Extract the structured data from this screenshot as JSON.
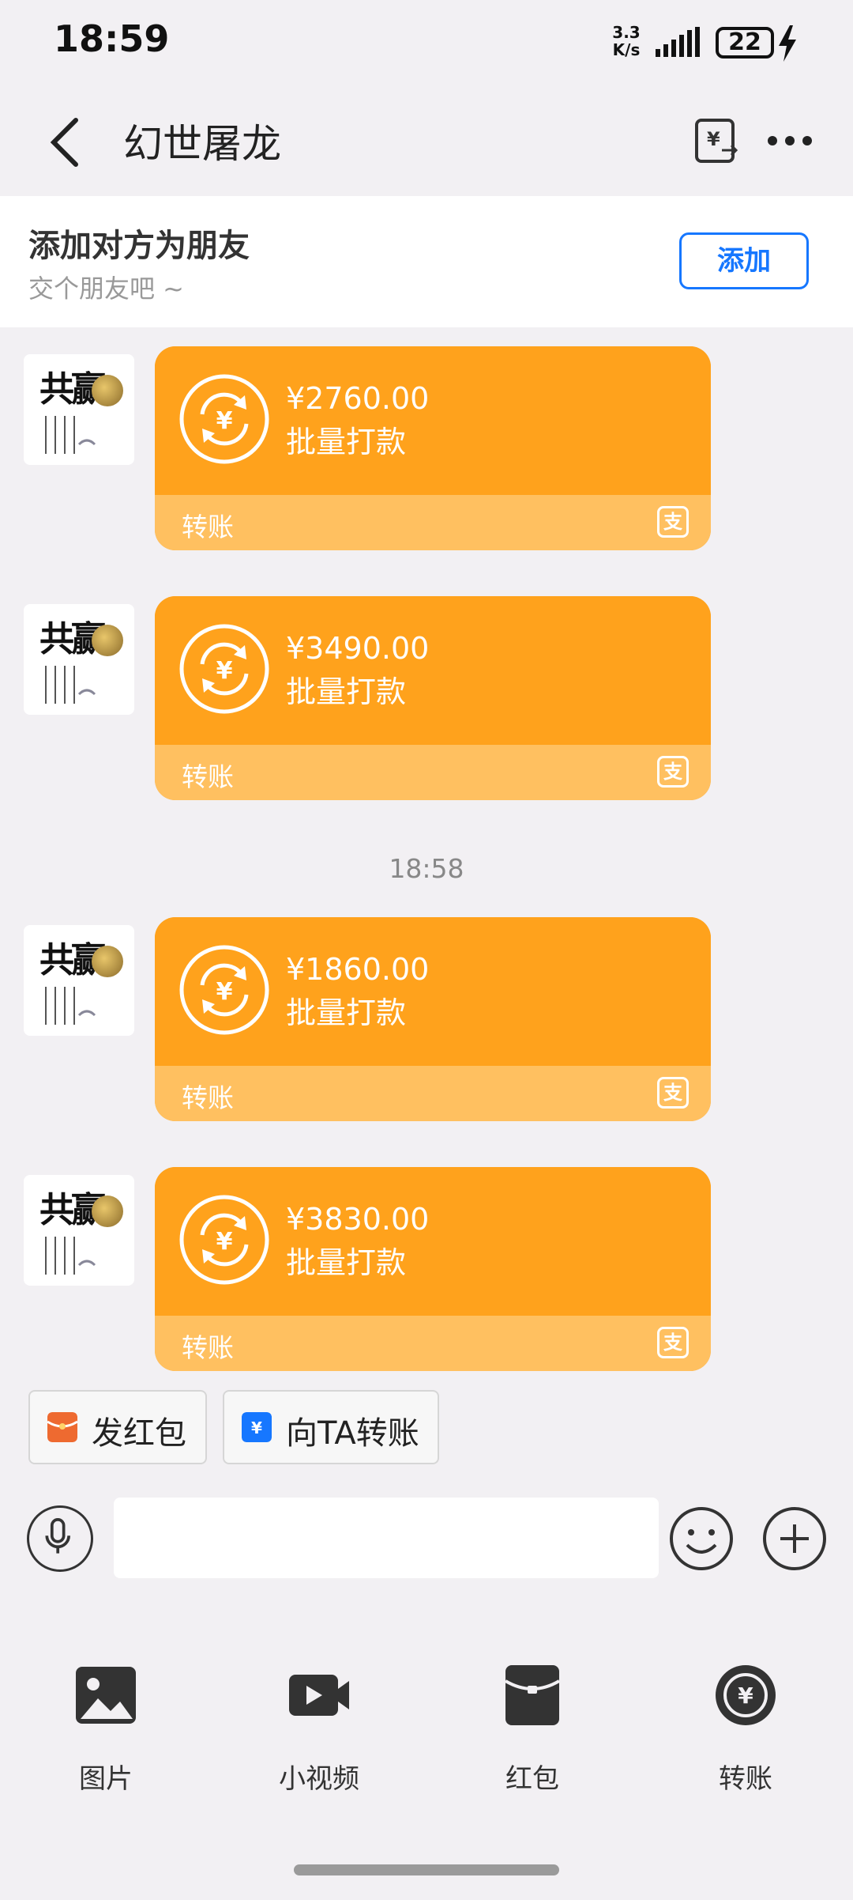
{
  "status_bar": {
    "time": "18:59",
    "net_speed": "3.3 K/s",
    "battery": "22"
  },
  "header": {
    "title": "幻世屠龙"
  },
  "banner": {
    "title": "添加对方为朋友",
    "subtitle": "交个朋友吧 ~",
    "add_label": "添加"
  },
  "messages": [
    {
      "amount": "¥2760.00",
      "desc": "批量打款",
      "label": "转账",
      "alipay_glyph": "支"
    },
    {
      "amount": "¥3490.00",
      "desc": "批量打款",
      "label": "转账",
      "alipay_glyph": "支"
    },
    {
      "amount": "¥1860.00",
      "desc": "批量打款",
      "label": "转账",
      "alipay_glyph": "支"
    },
    {
      "amount": "¥3830.00",
      "desc": "批量打款",
      "label": "转账",
      "alipay_glyph": "支"
    }
  ],
  "timestamp": "18:58",
  "avatar": {
    "text": "共赢"
  },
  "quick_actions": [
    {
      "label": "发红包",
      "icon": "red-envelope-icon",
      "color": "#ee6a30"
    },
    {
      "label": "向TA转账",
      "icon": "transfer-icon",
      "color": "#1677ff"
    }
  ],
  "panel": [
    {
      "label": "图片",
      "icon": "image-icon"
    },
    {
      "label": "小视频",
      "icon": "video-icon"
    },
    {
      "label": "红包",
      "icon": "red-packet-icon"
    },
    {
      "label": "转账",
      "icon": "transfer-circle-icon"
    }
  ],
  "colors": {
    "card_top": "#ffa21c",
    "card_bottom": "#ffc060",
    "accent_blue": "#1677ff"
  }
}
